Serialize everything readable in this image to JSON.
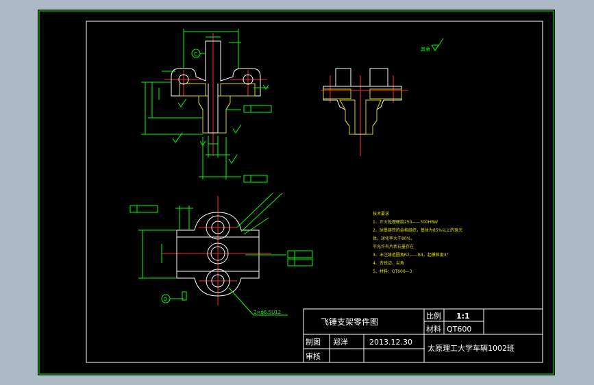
{
  "title_block": {
    "part_name": "飞锤支架零件图",
    "scale_label": "比例",
    "scale_value": "1:1",
    "material_label": "材料",
    "material_value": "QT600",
    "drawn_label": "制图",
    "drawn_by": "郑洋",
    "date": "2013.12.30",
    "review_label": "审核",
    "organization": "太原理工大学车辆1002班"
  },
  "tech_requirements": {
    "heading": "技术要求",
    "lines": [
      "1、正火处理硬度250——300HBW",
      "2、球墨铸铁的金相组织，基体为85%以上的珠光",
      "体，球化率大于80%，",
      "   不允许有片状石墨存在",
      "3、未注铸造圆角R2——R4，起模斜度3°",
      "4、去锐边、尖角",
      "5、材料：QT600—3"
    ]
  },
  "annotations": {
    "surface_other": "其余",
    "datum_c": "C",
    "datum_d": "D",
    "hole_note": "2×ϕ6.5U12"
  },
  "colors": {
    "frame": "#00ff00",
    "outline": "#ffffff",
    "centerline": "#ff2a2a",
    "hatch": "#d8d800",
    "dimension": "#00ff00",
    "background": "#000000",
    "workspace": "#aeb9c6"
  }
}
